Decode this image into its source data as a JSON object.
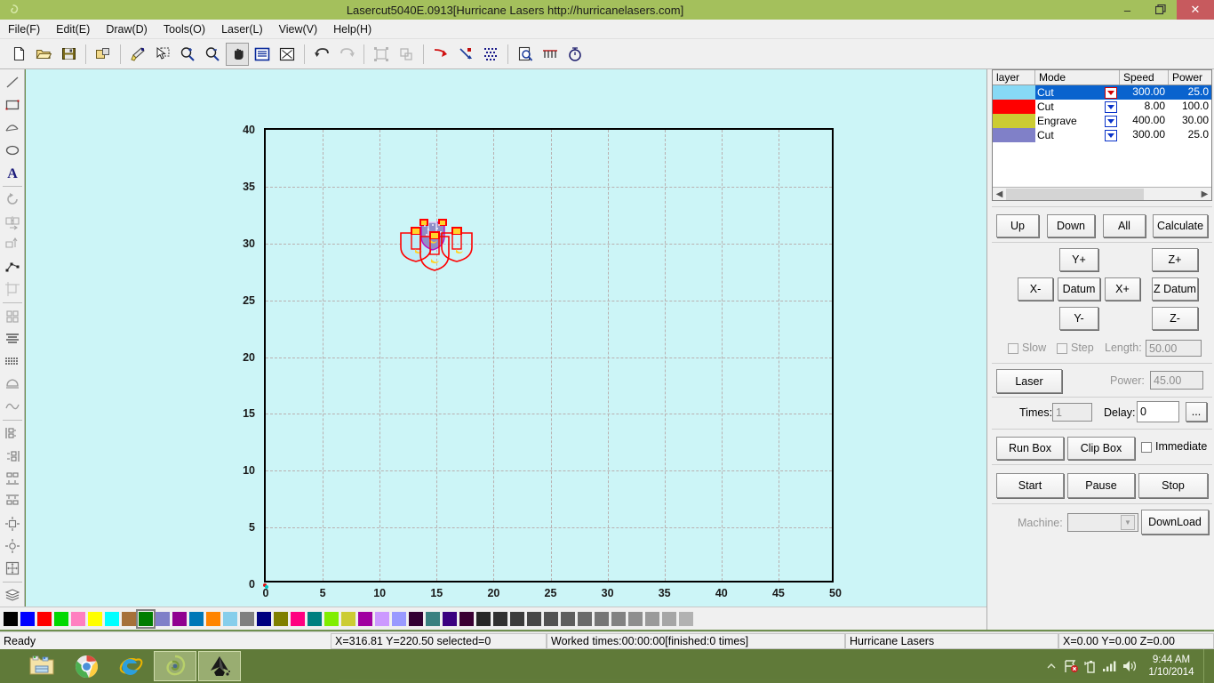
{
  "window": {
    "title": "Lasercut5040E.0913[Hurricane Lasers http://hurricanelasers.com]",
    "app_icon": "swirl-icon",
    "minimize_label": "–",
    "maximize_label": "❐",
    "close_label": "✕",
    "titlebar_color": "#a4c05c",
    "close_color": "#c75a5e"
  },
  "menubar": {
    "items": [
      {
        "label": "File(F)",
        "name": "menu-file"
      },
      {
        "label": "Edit(E)",
        "name": "menu-edit"
      },
      {
        "label": "Draw(D)",
        "name": "menu-draw"
      },
      {
        "label": "Tools(O)",
        "name": "menu-tools"
      },
      {
        "label": "Laser(L)",
        "name": "menu-laser"
      },
      {
        "label": "View(V)",
        "name": "menu-view"
      },
      {
        "label": "Help(H)",
        "name": "menu-help"
      }
    ]
  },
  "toolbar": {
    "buttons": [
      "new-file-icon",
      "open-folder-icon",
      "save-disk-icon",
      "sep",
      "export-icon",
      "sep",
      "paint-brush-icon",
      "select-arrow-icon",
      "zoom-in-icon",
      "zoom-out-icon",
      "pan-hand-icon",
      "fit-window-icon",
      "fit-selection-icon",
      "sep",
      "undo-icon",
      "redo-icon",
      "sep",
      "group-icon",
      "ungroup-icon",
      "sep",
      "arrow-right-icon",
      "node-edit-icon",
      "dither-icon",
      "sep",
      "preview-icon",
      "array-icon",
      "timer-icon"
    ],
    "pressed_index": 10
  },
  "left_toolbar": {
    "buttons": [
      "line-tool-icon",
      "rectangle-tool-icon",
      "polyline-tool-icon",
      "ellipse-tool-icon",
      "text-tool-icon",
      "sep",
      "rotate-icon",
      "mirror-horizontal-icon",
      "mirror-vertical-icon",
      "node-tool-icon",
      "crop-icon",
      "sep",
      "array-copy-icon",
      "align-text-icon",
      "bitmap-icon",
      "fill-icon",
      "curve-icon",
      "sep",
      "align-left-icon",
      "align-right-icon",
      "align-top-icon",
      "align-bottom-icon",
      "align-center-vertical-icon",
      "align-center-horizontal-icon",
      "distribute-icon",
      "sep",
      "layers-icon"
    ]
  },
  "canvas": {
    "background_color": "#ccf5f7",
    "grid_color": "#b9b0b0",
    "x_ticks": [
      "0",
      "5",
      "10",
      "15",
      "20",
      "25",
      "30",
      "35",
      "40",
      "45",
      "50"
    ],
    "y_ticks": [
      "0",
      "5",
      "10",
      "15",
      "20",
      "25",
      "30",
      "35",
      "40"
    ],
    "x_range": [
      0,
      50
    ],
    "y_range": [
      0,
      40
    ],
    "origin_marker": "origin-dot"
  },
  "palette": {
    "selected_index": 8,
    "colors": [
      "#000000",
      "#0000ff",
      "#ff0000",
      "#00d900",
      "#ff7fc0",
      "#ffff00",
      "#00ffff",
      "#a6713a",
      "#007d00",
      "#8080c8",
      "#900090",
      "#0077b7",
      "#ff8400",
      "#87ceeb",
      "#808080",
      "#000080",
      "#808000",
      "#ff0080",
      "#008080",
      "#80ee00",
      "#cccc33",
      "#a000a0",
      "#cc99ff",
      "#9999ff",
      "#330033",
      "#3a8080",
      "#3b0080",
      "#3a0033",
      "#262626",
      "#313131",
      "#3b3b3b",
      "#474747",
      "#525252",
      "#5e5e5e",
      "#6a6a6a",
      "#767676",
      "#828282",
      "#8e8e8e",
      "#9a9a9a",
      "#a6a6a6",
      "#b2b2b2"
    ]
  },
  "layer_panel": {
    "columns": [
      "layer",
      "Mode",
      "Speed",
      "Power"
    ],
    "rows": [
      {
        "color": "#87d9f5",
        "mode": "Cut",
        "speed": "300.00",
        "power": "25.0",
        "selected": true
      },
      {
        "color": "#ff0000",
        "mode": "Cut",
        "speed": "8.00",
        "power": "100.0",
        "selected": false
      },
      {
        "color": "#cccc33",
        "mode": "Engrave",
        "speed": "400.00",
        "power": "30.00",
        "selected": false
      },
      {
        "color": "#8080c8",
        "mode": "Cut",
        "speed": "300.00",
        "power": "25.0",
        "selected": false
      }
    ],
    "scroll_left_icon": "chevron-left-icon",
    "scroll_right_icon": "chevron-right-icon"
  },
  "controls": {
    "row_buttons": [
      {
        "label": "Up",
        "name": "up-button"
      },
      {
        "label": "Down",
        "name": "down-button"
      },
      {
        "label": "All",
        "name": "all-button"
      },
      {
        "label": "Calculate",
        "name": "calculate-button"
      }
    ],
    "jog": {
      "y_plus": "Y+",
      "y_minus": "Y-",
      "x_plus": "X+",
      "x_minus": "X-",
      "datum": "Datum",
      "z_plus": "Z+",
      "z_minus": "Z-",
      "z_datum": "Z Datum"
    },
    "slow_label": "Slow",
    "step_label": "Step",
    "length_label": "Length:",
    "length_value": "50.00",
    "laser_button": "Laser",
    "power_label": "Power:",
    "power_value": "45.00",
    "times_label": "Times:",
    "times_value": "1",
    "delay_label": "Delay:",
    "delay_value": "0",
    "ellipsis_button": "...",
    "run_box": "Run Box",
    "clip_box": "Clip Box",
    "immediate_label": "Immediate",
    "start": "Start",
    "pause": "Pause",
    "stop": "Stop",
    "machine_label": "Machine:",
    "machine_value": "",
    "download": "DownLoad"
  },
  "statusbar": {
    "ready": "Ready",
    "coords": "X=316.81 Y=220.50 selected=0",
    "worked": "Worked times:00:00:00[finished:0 times]",
    "machine_name": "Hurricane Lasers",
    "position": "X=0.00 Y=0.00 Z=0.00"
  },
  "taskbar": {
    "items": [
      {
        "name": "taskbar-file-explorer",
        "icon": "folder-icon",
        "active": false
      },
      {
        "name": "taskbar-chrome",
        "icon": "chrome-icon",
        "active": false
      },
      {
        "name": "taskbar-internet-explorer",
        "icon": "ie-icon",
        "active": false
      },
      {
        "name": "taskbar-lasercut",
        "icon": "swirl-icon",
        "active": true
      },
      {
        "name": "taskbar-inkscape",
        "icon": "inkscape-icon",
        "active": true
      }
    ],
    "tray": [
      "show-hidden-icon",
      "network-error-icon",
      "battery-icon",
      "signal-icon",
      "volume-icon"
    ],
    "clock_time": "9:44 AM",
    "clock_date": "1/10/2014"
  }
}
